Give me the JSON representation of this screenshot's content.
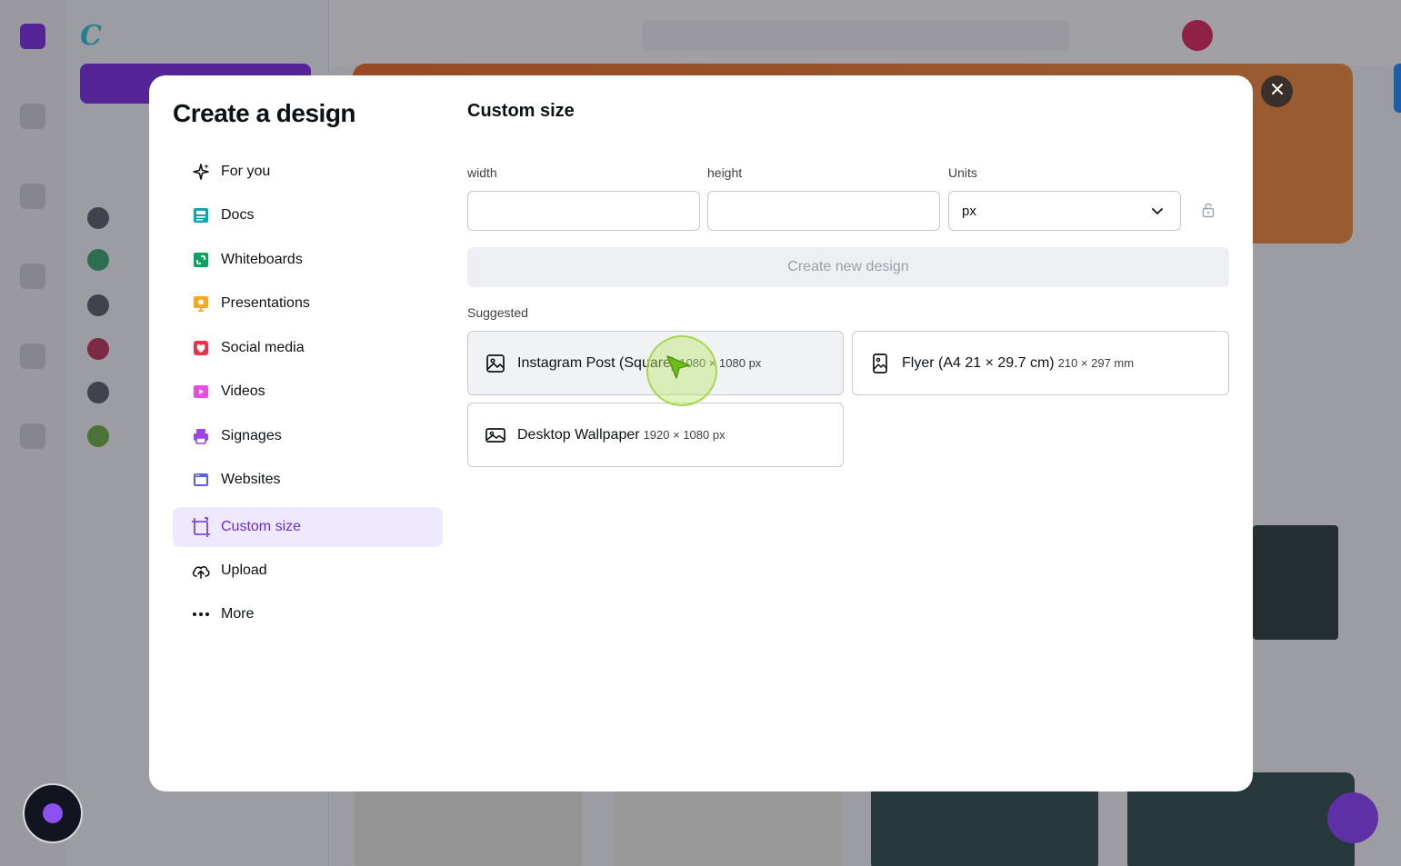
{
  "modal": {
    "title": "Create a design",
    "nav": [
      {
        "label": "For you",
        "icon": "sparkle-icon",
        "color": "#0d1216"
      },
      {
        "label": "Docs",
        "icon": "docs-icon",
        "color": "#13a3b5"
      },
      {
        "label": "Whiteboards",
        "icon": "whiteboard-icon",
        "color": "#0ba360"
      },
      {
        "label": "Presentations",
        "icon": "presentation-icon",
        "color": "#f5a623"
      },
      {
        "label": "Social media",
        "icon": "heart-icon",
        "color": "#e8334a"
      },
      {
        "label": "Videos",
        "icon": "video-icon",
        "color": "#e84de0"
      },
      {
        "label": "Signages",
        "icon": "printer-icon",
        "color": "#9b45e8"
      },
      {
        "label": "Websites",
        "icon": "website-icon",
        "color": "#5b5ce8"
      },
      {
        "label": "Custom size",
        "icon": "custom-size-icon",
        "color": "#6a2fd1",
        "active": true
      },
      {
        "label": "Upload",
        "icon": "cloud-upload-icon",
        "color": "#0d1216"
      },
      {
        "label": "More",
        "icon": "more-icon",
        "color": "#0d1216"
      }
    ],
    "content": {
      "title": "Custom size",
      "width_label": "width",
      "width_value": "",
      "height_label": "height",
      "height_value": "",
      "units_label": "Units",
      "units_value": "px",
      "create_button": "Create new design",
      "suggested_label": "Suggested",
      "suggestions": [
        {
          "name": "Instagram Post (Square)",
          "size": "1080 × 1080 px",
          "icon": "image-icon"
        },
        {
          "name": "Flyer (A4 21 × 29.7 cm)",
          "size": "210 × 297 mm",
          "icon": "portrait-image-icon"
        },
        {
          "name": "Desktop Wallpaper",
          "size": "1920 × 1080 px",
          "icon": "landscape-image-icon"
        }
      ]
    }
  },
  "colors": {
    "accent": "#6a2fd1",
    "active_bg": "#efe9fd"
  }
}
